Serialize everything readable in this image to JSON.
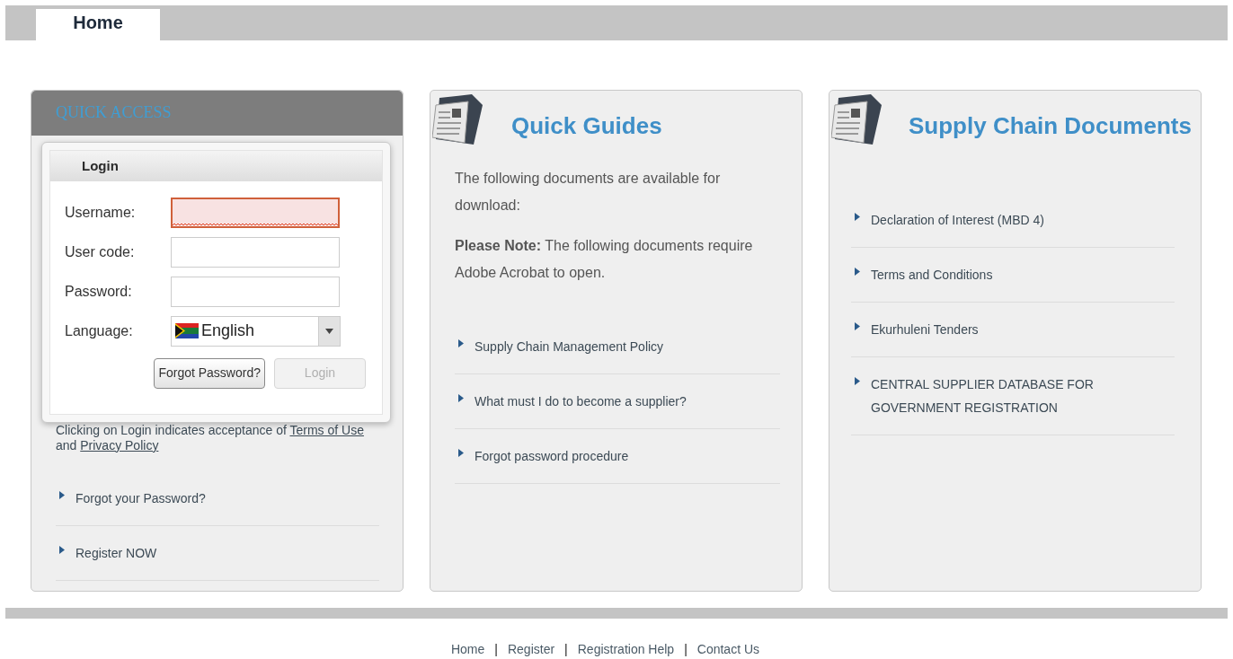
{
  "tabs": [
    {
      "label": "Home",
      "selected": true
    }
  ],
  "quick_access": {
    "title": "QUICK ACCESS",
    "login": {
      "title": "Login",
      "fields": [
        {
          "label": "Username:",
          "kind": "text",
          "error": true
        },
        {
          "label": "User code:",
          "kind": "text",
          "error": false
        },
        {
          "label": "Password:",
          "kind": "password",
          "error": false
        },
        {
          "label": "Language:",
          "kind": "select",
          "value": "English"
        }
      ],
      "buttons": [
        {
          "label": "Forgot Password?",
          "disabled": false
        },
        {
          "label": "Login",
          "disabled": true
        }
      ]
    },
    "terms_note": [
      {
        "kind": "text",
        "text": "Clicking on Login indicates acceptance of "
      },
      {
        "kind": "link",
        "text": "Terms of Use"
      },
      {
        "kind": "text",
        "text": " and "
      },
      {
        "kind": "link",
        "text": "Privacy Policy"
      }
    ],
    "links": [
      "Forgot your Password?",
      "Register NOW"
    ]
  },
  "quick_guides": {
    "title": "Quick Guides",
    "intro": "The following documents are available for download:",
    "note": "**Please Note:** The following documents require Adobe Acrobat to open.",
    "links": [
      "Supply Chain Management Policy",
      "What must I do to become a supplier?",
      "Forgot password procedure"
    ]
  },
  "supply_chain_documents": {
    "title": "Supply Chain Documents",
    "links": [
      "Declaration of Interest (MBD 4)",
      "Terms and Conditions",
      "Ekurhuleni Tenders",
      "CENTRAL SUPPLIER DATABASE FOR GOVERNMENT REGISTRATION"
    ]
  },
  "footer": [
    {
      "kind": "link",
      "text": "Home"
    },
    {
      "kind": "separator",
      "text": "|"
    },
    {
      "kind": "link",
      "text": "Register"
    },
    {
      "kind": "separator",
      "text": "|"
    },
    {
      "kind": "link",
      "text": "Registration Help"
    },
    {
      "kind": "separator",
      "text": "|"
    },
    {
      "kind": "link",
      "text": "Contact Us"
    }
  ]
}
